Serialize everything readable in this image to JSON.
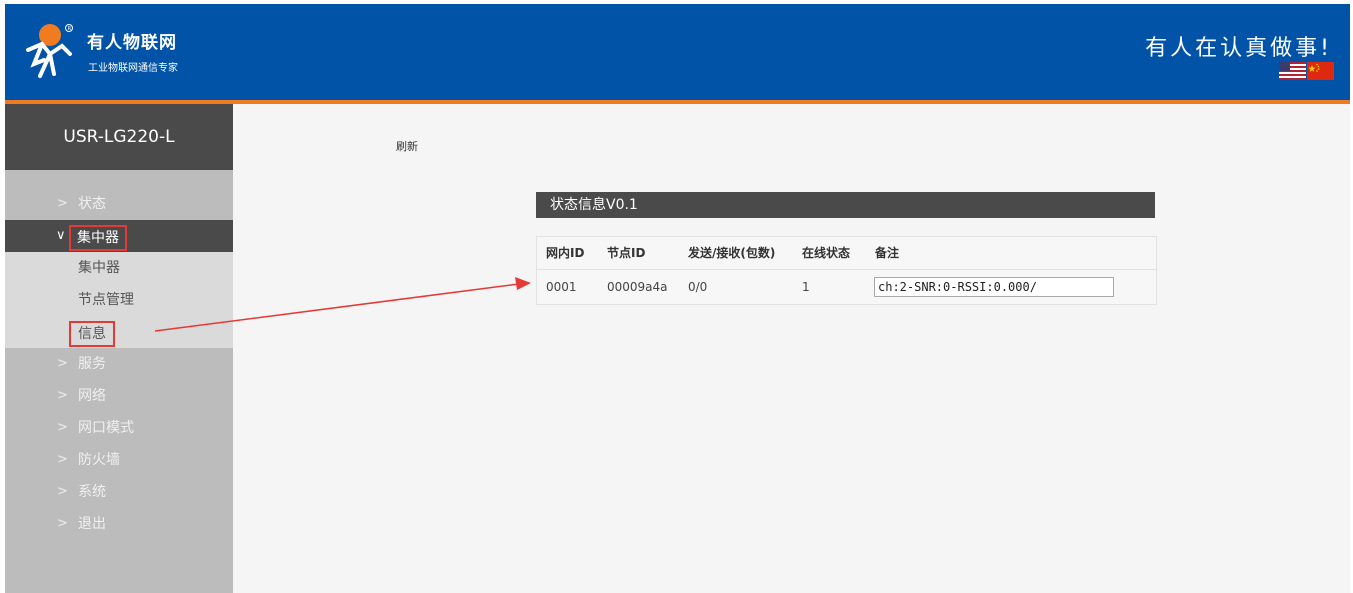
{
  "header": {
    "brand_name": "有人物联网",
    "brand_sub": "工业物联网通信专家",
    "slogan": "有人在认真做事!",
    "colors": {
      "bar": "#0053a6",
      "accent_line": "#f07c1f"
    }
  },
  "sidebar": {
    "device": "USR-LG220-L",
    "items": [
      {
        "label": "状态",
        "icon": "chevron-right-icon"
      },
      {
        "label": "集中器",
        "icon": "chevron-down-icon",
        "active": true
      },
      {
        "label": "服务",
        "icon": "chevron-right-icon"
      },
      {
        "label": "网络",
        "icon": "chevron-right-icon"
      },
      {
        "label": "网口模式",
        "icon": "chevron-right-icon"
      },
      {
        "label": "防火墙",
        "icon": "chevron-right-icon"
      },
      {
        "label": "系统",
        "icon": "chevron-right-icon"
      },
      {
        "label": "退出",
        "icon": "chevron-right-icon"
      }
    ],
    "subitems": [
      {
        "label": "集中器"
      },
      {
        "label": "节点管理"
      },
      {
        "label": "信息",
        "highlighted": true
      }
    ]
  },
  "main": {
    "refresh_label": "刷新",
    "panel_title": "状态信息V0.1",
    "table": {
      "headers": [
        "网内ID",
        "节点ID",
        "发送/接收(包数)",
        "在线状态",
        "备注"
      ],
      "rows": [
        {
          "net_id": "0001",
          "node_id": "00009a4a",
          "tx_rx": "0/0",
          "online": "1",
          "note": "ch:2-SNR:0-RSSI:0.000/"
        }
      ]
    }
  },
  "annotation": {
    "color": "#e53935"
  }
}
